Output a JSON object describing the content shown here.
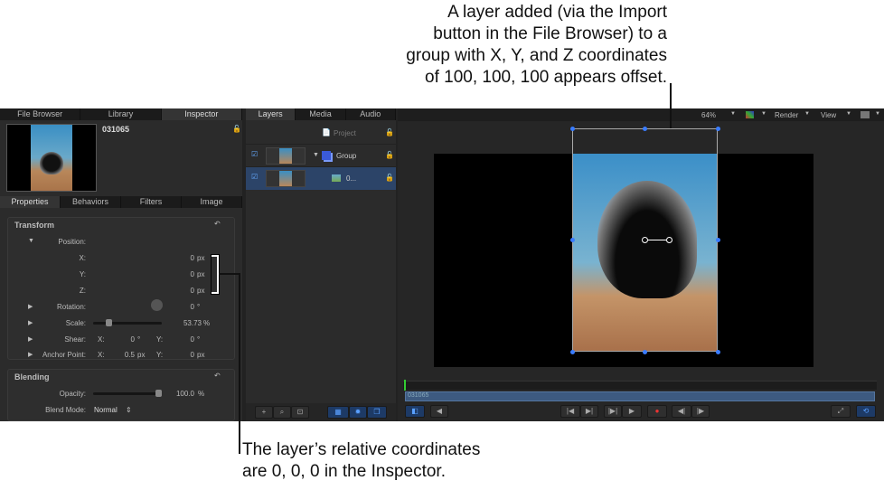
{
  "callouts": {
    "top": [
      "A layer added (via the Import",
      "button in the File Browser) to a",
      "group with X, Y, and Z coordinates",
      "of 100, 100, 100 appears offset."
    ],
    "bottom": [
      "The layer’s relative coordinates",
      "are 0, 0, 0 in the Inspector."
    ]
  },
  "left_tabs": [
    "File Browser",
    "Library",
    "Inspector"
  ],
  "inspector": {
    "object_name": "031065",
    "tabs": [
      "Properties",
      "Behaviors",
      "Filters",
      "Image"
    ],
    "transform": {
      "title": "Transform",
      "position_label": "Position:",
      "x_label": "X:",
      "x_value": "0",
      "y_label": "Y:",
      "y_value": "0",
      "z_label": "Z:",
      "z_value": "0",
      "unit": "px",
      "rotation_label": "Rotation:",
      "rotation_value": "0",
      "deg": "°",
      "scale_label": "Scale:",
      "scale_value": "53.73",
      "pct": "%",
      "scale_fraction": 0.2,
      "shear_label": "Shear:",
      "shear_x": "0",
      "shear_y": "0",
      "anchor_label": "Anchor Point:",
      "anchor_x": "0.5",
      "anchor_y": "0",
      "xl": "X:",
      "yl": "Y:"
    },
    "blending": {
      "title": "Blending",
      "opacity_label": "Opacity:",
      "opacity_value": "100.0",
      "blend_label": "Blend Mode:",
      "blend_value": "Normal",
      "opacity_fraction": 1.0
    }
  },
  "layers": {
    "tabs": [
      "Layers",
      "Media",
      "Audio"
    ],
    "project": "Project",
    "group": "Group",
    "layer": "0..."
  },
  "canvas": {
    "zoom": "64%",
    "render": "Render",
    "view": "View"
  },
  "timeline": {
    "clip": "031065"
  }
}
